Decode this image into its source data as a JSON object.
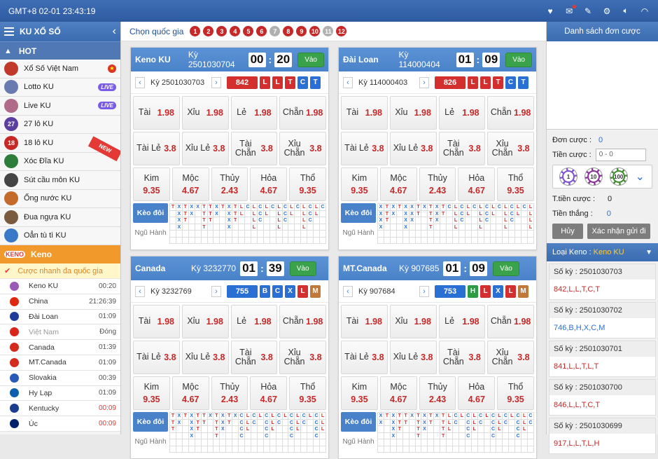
{
  "topbar": {
    "clock": "GMT+8 02-01 23:43:19"
  },
  "sidebar": {
    "title": "KU XỔ SỐ",
    "hot_label": "HOT",
    "games": [
      {
        "label": "Xổ Số Việt Nam",
        "icon": "vietnam-lottery-icon",
        "color": "#c0392b",
        "flag": "★"
      },
      {
        "label": "Lotto KU",
        "icon": "lotto-icon",
        "color": "#6a7bb0",
        "badge": "LIVE"
      },
      {
        "label": "Live KU",
        "icon": "live-host-icon",
        "color": "#b06a8a",
        "badge": "LIVE"
      },
      {
        "label": "27 lô KU",
        "icon": "lo-27-icon",
        "color": "#5b3fa0",
        "num": "27"
      },
      {
        "label": "18 lô KU",
        "icon": "lo-18-icon",
        "color": "#c62828",
        "num": "18"
      },
      {
        "label": "Xóc Đĩa KU",
        "icon": "xoc-dia-icon",
        "color": "#2f7d3a",
        "tag": "NEW"
      },
      {
        "label": "Sút cầu môn KU",
        "icon": "football-icon",
        "color": "#444"
      },
      {
        "label": "Ống nước KU",
        "icon": "pipe-icon",
        "color": "#c46a2a"
      },
      {
        "label": "Đua ngựa KU",
        "icon": "horse-icon",
        "color": "#7a5b40"
      },
      {
        "label": "Oẳn tù tì KU",
        "icon": "rock-paper-scissors-icon",
        "color": "#3a78c8"
      }
    ],
    "keno_label": "Keno",
    "keno_icon_text": "KENO",
    "quick_label": "Cược nhanh đa quốc gia",
    "countries": [
      {
        "label": "Keno KU",
        "time": "00:20",
        "red": false,
        "color": "#9b59b6"
      },
      {
        "label": "China",
        "time": "21:26:39",
        "red": false,
        "color": "#de2910"
      },
      {
        "label": "Đài Loan",
        "time": "01:09",
        "red": false,
        "color": "#1f3c99"
      },
      {
        "label": "Việt Nam",
        "time": "Đóng",
        "red": false,
        "color": "#da251d",
        "dim": true
      },
      {
        "label": "Canada",
        "time": "01:39",
        "red": false,
        "color": "#d52b1e"
      },
      {
        "label": "MT.Canada",
        "time": "01:09",
        "red": false,
        "color": "#d52b1e"
      },
      {
        "label": "Slovakia",
        "time": "00:39",
        "red": false,
        "color": "#2a5ab8"
      },
      {
        "label": "Hy Lạp",
        "time": "01:09",
        "red": false,
        "color": "#0d5eaf"
      },
      {
        "label": "Kentucky",
        "time": "00:09",
        "red": true,
        "color": "#1a3d8f"
      },
      {
        "label": "Úc",
        "time": "00:09",
        "red": true,
        "color": "#012169"
      }
    ]
  },
  "countrybar": {
    "label": "Chọn quốc gia",
    "numbers": [
      {
        "n": "1",
        "grey": false
      },
      {
        "n": "2",
        "grey": false
      },
      {
        "n": "3",
        "grey": false
      },
      {
        "n": "4",
        "grey": false
      },
      {
        "n": "5",
        "grey": false
      },
      {
        "n": "6",
        "grey": false
      },
      {
        "n": "7",
        "grey": true
      },
      {
        "n": "8",
        "grey": false
      },
      {
        "n": "9",
        "grey": false
      },
      {
        "n": "10",
        "grey": false
      },
      {
        "n": "11",
        "grey": true
      },
      {
        "n": "12",
        "grey": false
      }
    ]
  },
  "bets": {
    "row1": [
      {
        "name": "Tài",
        "odds": "1.98"
      },
      {
        "name": "Xỉu",
        "odds": "1.98"
      },
      {
        "name": "Lẻ",
        "odds": "1.98"
      },
      {
        "name": "Chẵn",
        "odds": "1.98"
      }
    ],
    "row2": [
      {
        "name": "Tài Lẻ",
        "odds": "3.8"
      },
      {
        "name": "Xỉu Lẻ",
        "odds": "3.8"
      },
      {
        "name": "Tài Chẵn",
        "odds": "3.8"
      },
      {
        "name": "Xỉu Chẵn",
        "odds": "3.8"
      }
    ],
    "elements": [
      {
        "name": "Kim",
        "odds": "9.35"
      },
      {
        "name": "Mộc",
        "odds": "4.67"
      },
      {
        "name": "Thủy",
        "odds": "2.43"
      },
      {
        "name": "Hỏa",
        "odds": "4.67"
      },
      {
        "name": "Thổ",
        "odds": "9.35"
      }
    ],
    "keo_doi": "Kèo đôi",
    "ngu_hanh": "Ngũ Hành",
    "vao": "Vào"
  },
  "panels": [
    {
      "name": "Keno KU",
      "ky": "Kỳ 2501030704",
      "mm": "00",
      "ss": "20",
      "prev": "Kỳ 2501030703",
      "result": "842",
      "numcolor": "#d32f2f",
      "chars": [
        {
          "c": "L",
          "col": "#d32f2f"
        },
        {
          "c": "L",
          "col": "#d32f2f"
        },
        {
          "c": "T",
          "col": "#d32f2f"
        },
        {
          "c": "C",
          "col": "#2a6fd4"
        },
        {
          "c": "T",
          "col": "#2a6fd4"
        }
      ],
      "road": [
        "T",
        "X",
        "T",
        "X",
        "X",
        "T",
        "T",
        "X",
        "T",
        "X",
        "T",
        "L",
        "C",
        "L",
        "C",
        "L",
        "C",
        "L",
        "C",
        "L",
        "C",
        "L",
        "C",
        "L",
        "C"
      ]
    },
    {
      "name": "Đài Loan",
      "ky": "Kỳ 114000404",
      "mm": "01",
      "ss": "09",
      "prev": "Kỳ 114000403",
      "result": "826",
      "numcolor": "#d32f2f",
      "chars": [
        {
          "c": "L",
          "col": "#d32f2f"
        },
        {
          "c": "L",
          "col": "#d32f2f"
        },
        {
          "c": "T",
          "col": "#d32f2f"
        },
        {
          "c": "C",
          "col": "#2a6fd4"
        },
        {
          "c": "T",
          "col": "#2a6fd4"
        }
      ],
      "road": [
        "X",
        "T",
        "X",
        "T",
        "X",
        "X",
        "T",
        "X",
        "T",
        "X",
        "T",
        "C",
        "L",
        "C",
        "L",
        "C",
        "L",
        "C",
        "L",
        "C",
        "L",
        "C",
        "L",
        "C",
        "L"
      ]
    },
    {
      "name": "Canada",
      "ky": "Kỳ 3232770",
      "mm": "01",
      "ss": "39",
      "prev": "Kỳ 3232769",
      "result": "755",
      "numcolor": "#2a6fd4",
      "chars": [
        {
          "c": "B",
          "col": "#2a6fd4"
        },
        {
          "c": "C",
          "col": "#2a6fd4"
        },
        {
          "c": "X",
          "col": "#2a6fd4"
        },
        {
          "c": "L",
          "col": "#d32f2f"
        },
        {
          "c": "M",
          "col": "#c0793a"
        }
      ],
      "road": [
        "T",
        "X",
        "T",
        "X",
        "T",
        "T",
        "X",
        "T",
        "X",
        "T",
        "X",
        "C",
        "L",
        "C",
        "L",
        "C",
        "L",
        "C",
        "L",
        "C",
        "L",
        "C",
        "L",
        "C",
        "L"
      ]
    },
    {
      "name": "MT.Canada",
      "ky": "Kỳ 907685",
      "mm": "01",
      "ss": "09",
      "prev": "Kỳ 907684",
      "result": "753",
      "numcolor": "#2a6fd4",
      "chars": [
        {
          "c": "H",
          "col": "#2e9b44"
        },
        {
          "c": "L",
          "col": "#d32f2f"
        },
        {
          "c": "X",
          "col": "#2a6fd4"
        },
        {
          "c": "L",
          "col": "#d32f2f"
        },
        {
          "c": "M",
          "col": "#c0793a"
        }
      ],
      "road": [
        "X",
        "T",
        "X",
        "T",
        "T",
        "X",
        "T",
        "X",
        "T",
        "X",
        "T",
        "L",
        "C",
        "L",
        "C",
        "L",
        "C",
        "L",
        "C",
        "L",
        "C",
        "L",
        "C",
        "L",
        "C"
      ]
    }
  ],
  "right": {
    "title": "Danh sách đơn cược",
    "don_cuoc_label": "Đơn cược :",
    "don_cuoc_value": "0",
    "tien_cuoc_label": "Tiền cược :",
    "tien_cuoc_placeholder": "0 - 0",
    "chips": [
      {
        "v": "1",
        "color": "#7b4fd6"
      },
      {
        "v": "10",
        "color": "#8e2f9e"
      },
      {
        "v": "100",
        "color": "#3f8c2f"
      }
    ],
    "t_tien_label": "T.tiền cược :",
    "t_tien_value": "0",
    "tien_thang_label": "Tiền thắng :",
    "tien_thang_value": "0",
    "huy": "Hủy",
    "confirm": "Xác nhận gửi đi",
    "loai_label": "Loại Keno :",
    "loai_value": "Keno KU",
    "history": [
      {
        "ky": "Số kỳ : 2501030703",
        "res": "842,L,L,T,C,T"
      },
      {
        "ky": "Số kỳ : 2501030702",
        "res": "746,B,H,X,C,M"
      },
      {
        "ky": "Số kỳ : 2501030701",
        "res": "841,L,L,T,L,T"
      },
      {
        "ky": "Số kỳ : 2501030700",
        "res": "846,L,L,T,C,T"
      },
      {
        "ky": "Số kỳ : 2501030699",
        "res": "917,L,L,T,L,H"
      }
    ]
  }
}
